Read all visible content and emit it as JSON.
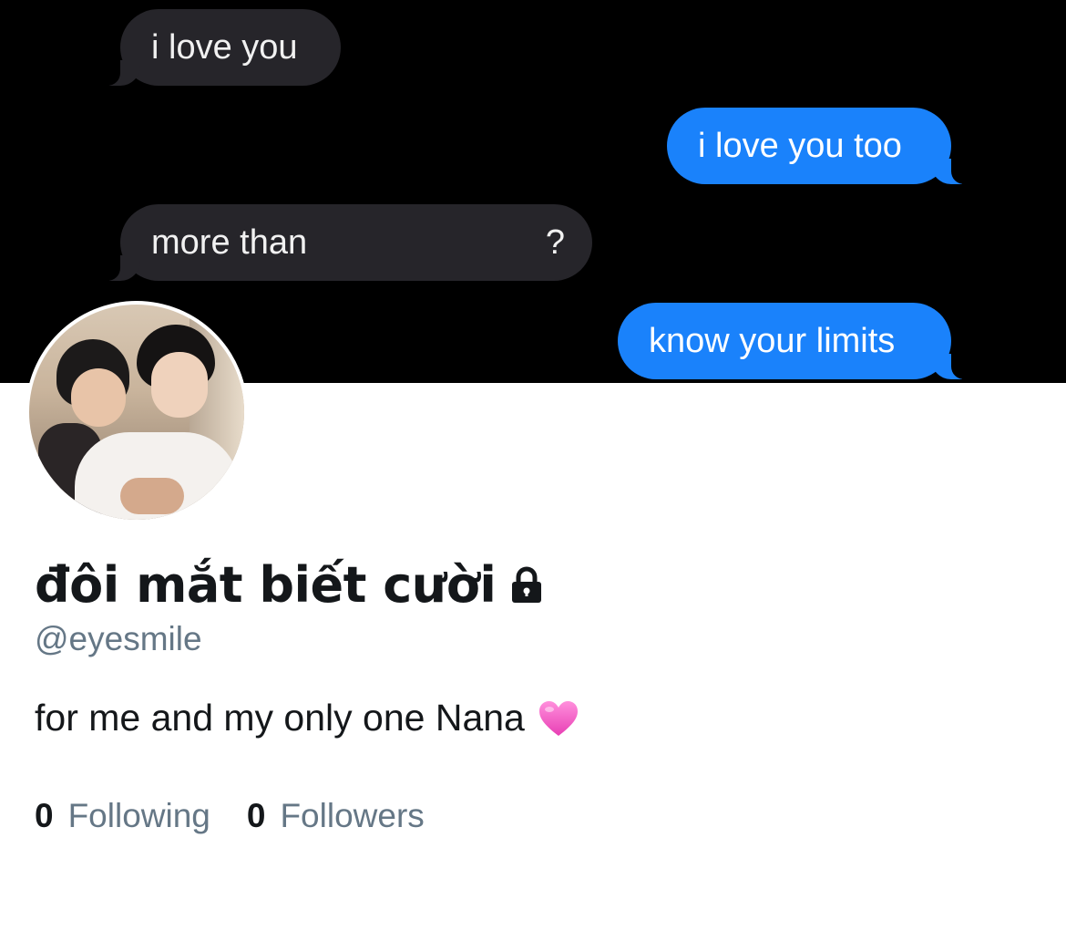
{
  "header": {
    "messages": [
      {
        "text": "i love you",
        "side": "incoming"
      },
      {
        "text": "i love you too",
        "side": "outgoing"
      },
      {
        "text": "more than",
        "trailing": "?",
        "side": "incoming"
      },
      {
        "text": "know your limits",
        "side": "outgoing"
      }
    ],
    "colors": {
      "background": "#000000",
      "incoming_bubble": "#26252a",
      "outgoing_bubble": "#1a82fb"
    }
  },
  "profile": {
    "display_name": "đôi mắt biết cười",
    "protected_icon": "lock-icon",
    "handle": "@eyesmile",
    "bio": "for me and my only one Nana",
    "bio_emoji": "pink-heart-icon",
    "stats": {
      "following_count": "0",
      "following_label": "Following",
      "followers_count": "0",
      "followers_label": "Followers"
    },
    "colors": {
      "name": "#14171a",
      "secondary_text": "#657786",
      "heart": "#f45bc6"
    }
  }
}
